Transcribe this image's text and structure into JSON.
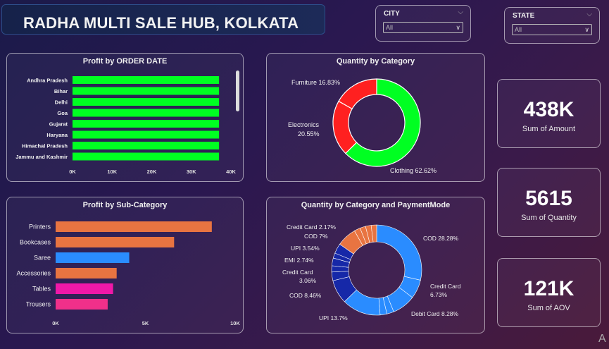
{
  "header": {
    "title": "RADHA MULTI SALE HUB, KOLKATA"
  },
  "slicers": {
    "city": {
      "label": "CITY",
      "value": "All"
    },
    "state": {
      "label": "STATE",
      "value": "All"
    }
  },
  "kpis": [
    {
      "value": "438K",
      "label": "Sum of Amount"
    },
    {
      "value": "5615",
      "label": "Sum of Quantity"
    },
    {
      "value": "121K",
      "label": "Sum of AOV"
    }
  ],
  "watermark": "A",
  "colors": {
    "green": "#00ff22",
    "red": "#ff2020",
    "orange": "#e87441",
    "blue": "#2a8cff",
    "magenta": "#f018a8",
    "pink": "#f0308a",
    "navy": "#1628a8",
    "midblue": "#1e5fd8"
  },
  "chart_data": [
    {
      "type": "bar",
      "orientation": "horizontal",
      "title": "Profit by ORDER DATE",
      "categories": [
        "Andhra Pradesh",
        "Bihar",
        "Delhi",
        "Goa",
        "Gujarat",
        "Haryana",
        "Himachal Pradesh",
        "Jammu and Kashmir"
      ],
      "values": [
        37000,
        37000,
        37000,
        37000,
        37000,
        37000,
        37000,
        37000
      ],
      "xlim": [
        0,
        40000
      ],
      "ticks": [
        "0K",
        "10K",
        "20K",
        "30K",
        "40K"
      ],
      "tick_values": [
        0,
        10000,
        20000,
        30000,
        40000
      ]
    },
    {
      "type": "pie",
      "donut": true,
      "title": "Quantity by Category",
      "slices": [
        {
          "label": "Clothing 62.62%",
          "value": 62.62,
          "color": "#00ff22"
        },
        {
          "label": "Electronics 20.55%",
          "value": 20.55,
          "color": "#ff2020"
        },
        {
          "label": "Furniture 16.83%",
          "value": 16.83,
          "color": "#ff2020"
        }
      ]
    },
    {
      "type": "bar",
      "orientation": "horizontal",
      "title": "Profit by Sub-Category",
      "categories": [
        "Printers",
        "Bookcases",
        "Saree",
        "Accessories",
        "Tables",
        "Trousers"
      ],
      "values": [
        8700,
        6600,
        4100,
        3400,
        3200,
        2900
      ],
      "colors": [
        "#e87441",
        "#e87441",
        "#2a8cff",
        "#e87441",
        "#f018a8",
        "#f0308a"
      ],
      "xlim": [
        0,
        10000
      ],
      "ticks": [
        "0K",
        "5K",
        "10K"
      ],
      "tick_values": [
        0,
        5000,
        10000
      ]
    },
    {
      "type": "pie",
      "donut": true,
      "title": "Quantity by Category and PaymentMode",
      "slices": [
        {
          "label": "COD 28.28%",
          "value": 28.28,
          "color": "#2a8cff"
        },
        {
          "label": "Credit Card 6.73%",
          "value": 6.73,
          "color": "#2a8cff"
        },
        {
          "label": "Debit Card 8.28%",
          "value": 8.28,
          "color": "#2a8cff"
        },
        {
          "label": "",
          "value": 2.5,
          "color": "#2a8cff"
        },
        {
          "label": "",
          "value": 2.4,
          "color": "#2a8cff"
        },
        {
          "label": "UPI 13.7%",
          "value": 13.7,
          "color": "#2a8cff"
        },
        {
          "label": "COD 8.46%",
          "value": 8.46,
          "color": "#1628a8"
        },
        {
          "label": "Credit Card 3.06%",
          "value": 3.06,
          "color": "#1628a8"
        },
        {
          "label": "",
          "value": 2.2,
          "color": "#1628a8"
        },
        {
          "label": "EMI 2.74%",
          "value": 2.74,
          "color": "#1628a8"
        },
        {
          "label": "",
          "value": 1.8,
          "color": "#1628a8"
        },
        {
          "label": "UPI 3.54%",
          "value": 3.54,
          "color": "#1628a8"
        },
        {
          "label": "COD 7%",
          "value": 7.0,
          "color": "#e87441"
        },
        {
          "label": "Credit Card 2.17%",
          "value": 2.17,
          "color": "#e87441"
        },
        {
          "label": "",
          "value": 2.0,
          "color": "#e87441"
        },
        {
          "label": "",
          "value": 2.0,
          "color": "#e87441"
        },
        {
          "label": "",
          "value": 1.94,
          "color": "#e87441"
        }
      ]
    }
  ]
}
